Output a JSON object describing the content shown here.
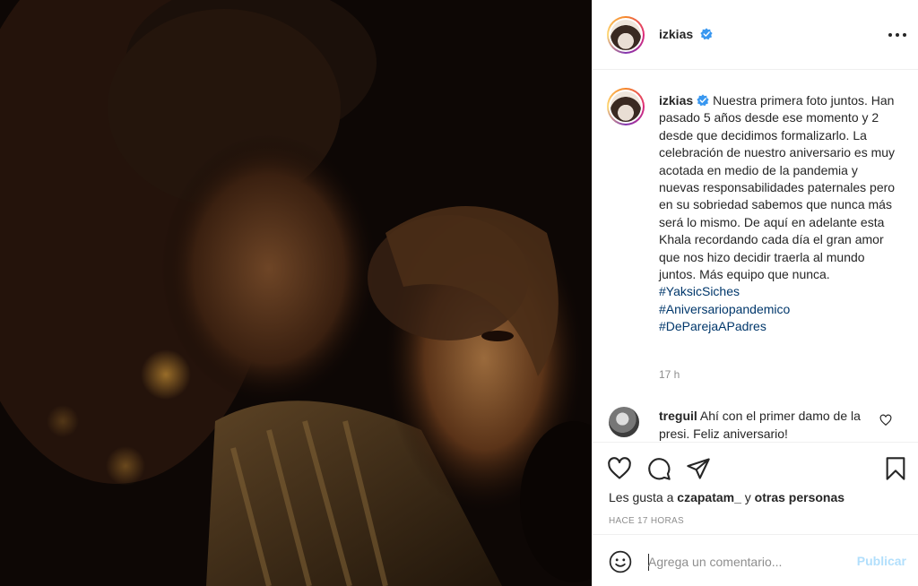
{
  "post": {
    "author": "izkias",
    "verified": true,
    "caption_text": "Nuestra primera foto juntos. Han pasado 5 años desde ese momento y 2 desde que decidimos formalizarlo. La celebración de nuestro aniversario es muy acotada en medio de la pandemia y nuevas responsabilidades paternales pero en su sobriedad sabemos que nunca más será lo mismo. De aquí en adelante esta Khala recordando cada día el gran amor que nos hizo decidir traerla al mundo juntos. Más equipo que nunca.",
    "hashtags": [
      "#YaksicSiches",
      "#Aniversariopandemico",
      "#DeParejaAPadres"
    ],
    "caption_time": "17 h"
  },
  "comment": {
    "author": "treguil",
    "text": "Ahí con el primer damo de la presi. Feliz aniversario!"
  },
  "likes": {
    "prefix": "Les gusta a",
    "user": "czapatam_",
    "conjunction": "y",
    "others": "otras personas"
  },
  "timestamp": "HACE 17 HORAS",
  "add_comment": {
    "placeholder": "Agrega un comentario...",
    "publish_label": "Publicar"
  },
  "icons": {
    "like": "heart-icon",
    "comment": "comment-icon",
    "share": "paper-plane-icon",
    "save": "bookmark-icon",
    "emoji": "smiley-icon",
    "more": "more-dots-icon",
    "verified": "verified-badge-icon"
  },
  "colors": {
    "text": "#262626",
    "hashtag": "#00376b",
    "muted": "#8e8e8e",
    "verified": "#3897f0",
    "publish_disabled": "#b2dffc"
  }
}
